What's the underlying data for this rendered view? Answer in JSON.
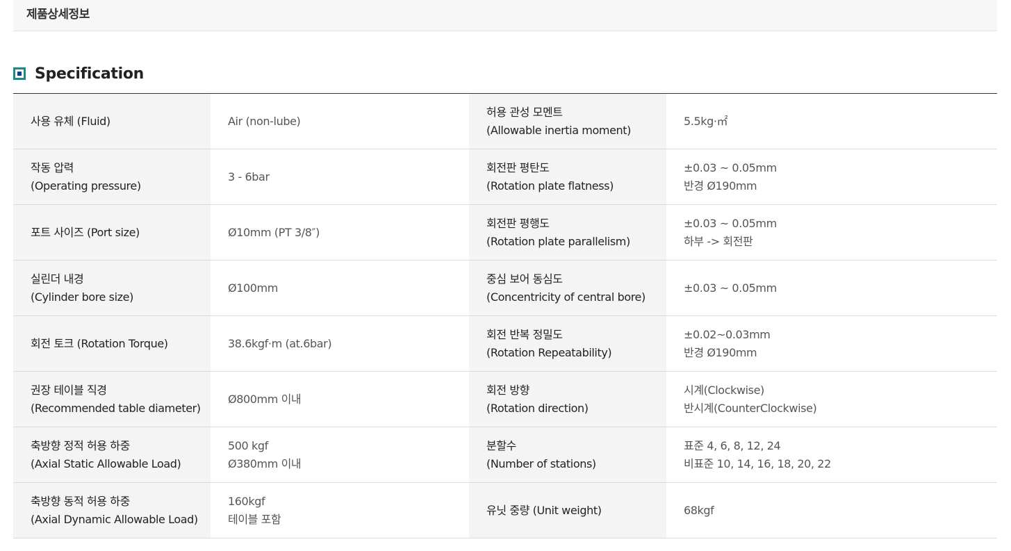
{
  "tab": {
    "title": "제품상세정보"
  },
  "section": {
    "title": "Specification"
  },
  "rows": [
    {
      "label1": "사용 유체 (Fluid)",
      "value1": "Air (non-lube)",
      "label2": "허용 관성 모멘트\n(Allowable inertia moment)",
      "value2": "5.5kg·㎡"
    },
    {
      "label1": "작동 압력\n(Operating pressure)",
      "value1": "3 - 6bar",
      "label2": "회전판 평탄도\n(Rotation plate flatness)",
      "value2": "±0.03 ~ 0.05mm\n반경 Ø190mm"
    },
    {
      "label1": "포트 사이즈 (Port size)",
      "value1": "Ø10mm (PT 3/8″)",
      "label2": "회전판 평행도\n(Rotation plate parallelism)",
      "value2": "±0.03 ~ 0.05mm\n하부 -> 회전판"
    },
    {
      "label1": "실린더 내경\n(Cylinder bore size)",
      "value1": "Ø100mm",
      "label2": "중심 보어 동심도\n(Concentricity of central bore)",
      "value2": "±0.03 ~ 0.05mm"
    },
    {
      "label1": "회전 토크 (Rotation Torque)",
      "value1": "38.6kgf·m (at.6bar)",
      "label2": "회전 반복 정밀도\n(Rotation Repeatability)",
      "value2": "±0.02~0.03mm\n반경 Ø190mm"
    },
    {
      "label1": "권장 테이블 직경\n(Recommended table diameter)",
      "value1": "Ø800mm 이내",
      "label2": "회전 방향\n(Rotation direction)",
      "value2": "시계(Clockwise)\n반시계(CounterClockwise)"
    },
    {
      "label1": "축방향 정적 허용 하중\n(Axial Static Allowable Load)",
      "value1": "500 kgf\nØ380mm 이내",
      "label2": "분할수\n(Number of stations)",
      "value2": "표준 4, 6, 8, 12, 24\n비표준 10, 14, 16, 18, 20, 22"
    },
    {
      "label1": "축방향 동적 허용 하중\n(Axial Dynamic Allowable Load)",
      "value1": "160kgf\n테이블 포함",
      "label2": "유닛 중량 (Unit weight)",
      "value2": "68kgf"
    }
  ],
  "colors": {
    "accent_border": "#1b8a8a",
    "accent_fill": "#0a3f9b",
    "label_bg": "#f4f4f4"
  }
}
